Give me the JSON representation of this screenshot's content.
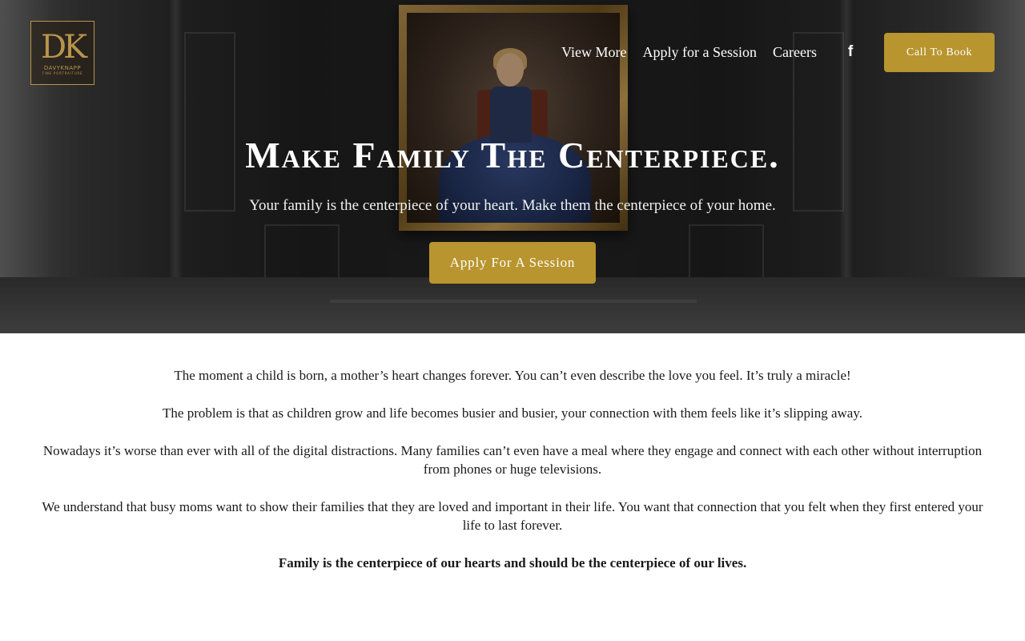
{
  "brand": {
    "logo_mark": "DK",
    "logo_name": "DAVYKNAPP",
    "logo_tagline": "FINE PORTRAITURE"
  },
  "nav": {
    "items": [
      {
        "label": "View More"
      },
      {
        "label": "Apply for a Session"
      },
      {
        "label": "Careers"
      }
    ],
    "social_icon": "facebook-icon",
    "cta_label": "Call To Book"
  },
  "hero": {
    "title": "Make Family The Centerpiece.",
    "subtitle": "Your family is the centerpiece of your heart. Make them the centerpiece of your home.",
    "button_label": "Apply For A Session"
  },
  "body": {
    "paragraphs": [
      "The moment a child is born, a mother’s heart changes forever. You can’t even describe the love you feel. It’s truly a miracle!",
      "The problem is that as children grow and life becomes busier and busier, your connection with them feels like it’s slipping away.",
      "Nowadays it’s worse than ever with all of the digital distractions. Many families can’t even have a meal where they engage and connect with each other without interruption from phones or huge televisions.",
      "We understand that busy moms want to show their families that they are loved and important in their life. You want that connection that you felt when they first entered your life to last forever.",
      "Family is the centerpiece of our hearts and should be the centerpiece of our lives."
    ]
  },
  "colors": {
    "accent": "#b8952e",
    "hero_overlay": "#2b2b2b",
    "body_text": "#1a1a1a"
  }
}
